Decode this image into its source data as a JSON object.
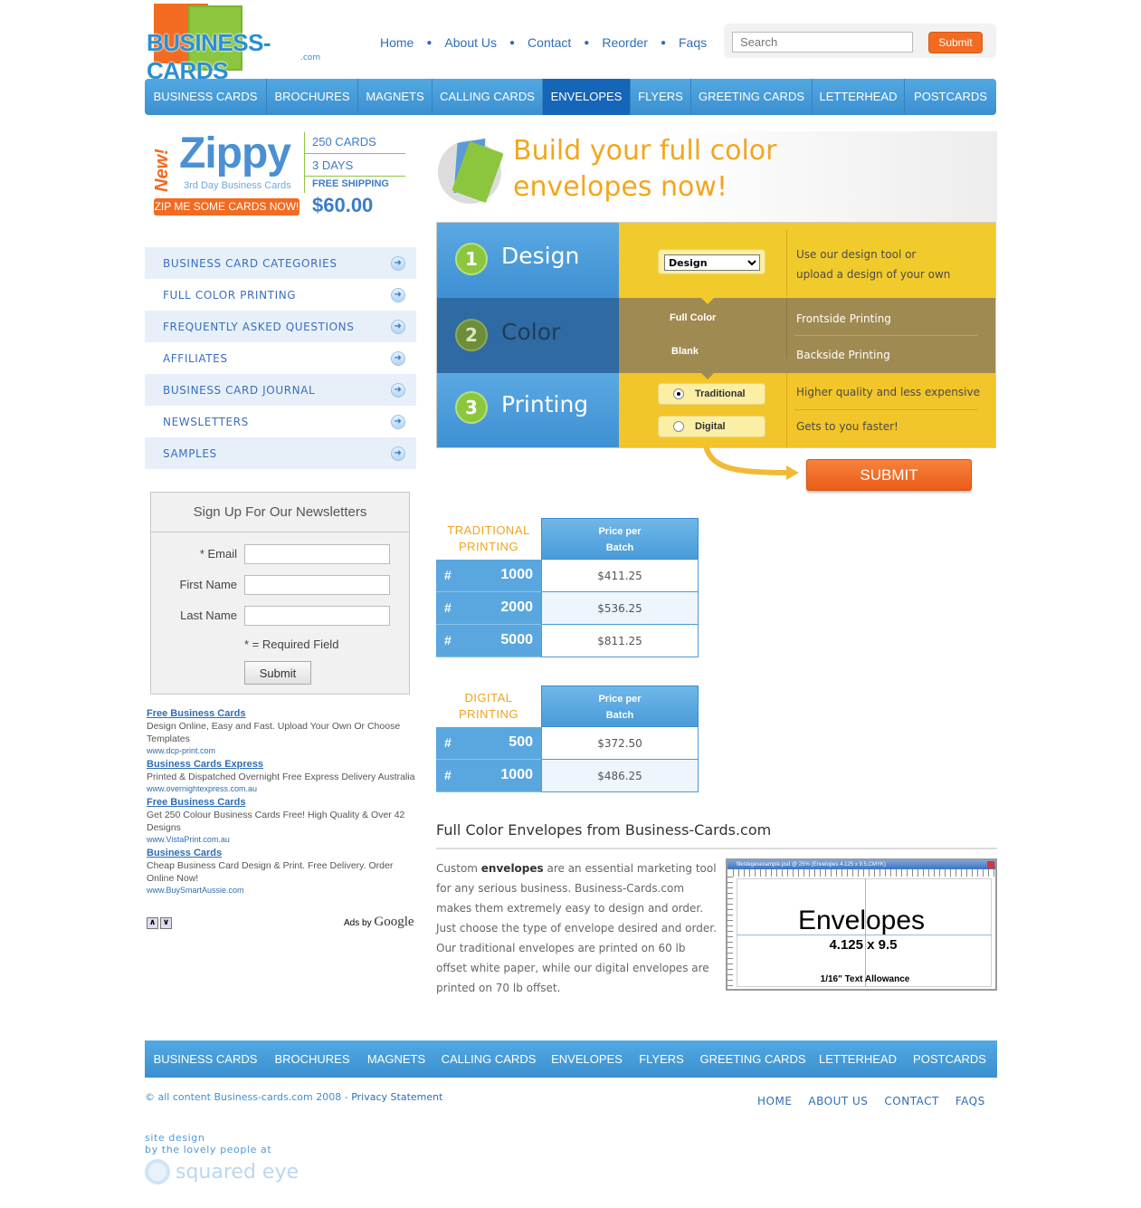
{
  "logo": {
    "text": "BUSINESS-CARDS",
    "suffix": ".com"
  },
  "top_nav": [
    "Home",
    "About Us",
    "Contact",
    "Reorder",
    "Faqs"
  ],
  "search": {
    "placeholder": "Search",
    "submit": "Submit"
  },
  "main_nav": {
    "items": [
      "BUSINESS CARDS",
      "BROCHURES",
      "MAGNETS",
      "CALLING CARDS",
      "ENVELOPES",
      "FLYERS",
      "GREETING CARDS",
      "LETTERHEAD",
      "POSTCARDS"
    ],
    "active": "ENVELOPES"
  },
  "promo": {
    "new": "New!",
    "title": "Zippy",
    "subtitle": "3rd Day Business Cards",
    "cta": "ZIP ME SOME CARDS NOW!",
    "cards": "250 CARDS",
    "days": "3 DAYS",
    "shipping": "FREE SHIPPING",
    "price": "$60.00"
  },
  "side_menu": [
    "BUSINESS CARD CATEGORIES",
    "FULL COLOR PRINTING",
    "FREQUENTLY ASKED QUESTIONS",
    "AFFILIATES",
    "BUSINESS CARD JOURNAL",
    "NEWSLETTERS",
    "SAMPLES"
  ],
  "newsletter": {
    "title": "Sign Up For Our Newsletters",
    "email_label": "* Email",
    "first_name_label": "First Name",
    "last_name_label": "Last Name",
    "required_note": "* = Required Field",
    "submit": "Submit"
  },
  "ads": [
    {
      "title": "Free Business Cards",
      "desc": "Design Online, Easy and Fast. Upload Your Own Or Choose Templates",
      "url": "www.dcp-print.com"
    },
    {
      "title": "Business Cards Express",
      "desc": "Printed & Dispatched Overnight Free Express Delivery Australia",
      "url": "www.overnightexpress.com.au"
    },
    {
      "title": "Free Business Cards",
      "desc": "Get 250 Colour Business Cards Free! High Quality & Over 42 Designs",
      "url": "www.VistaPrint.com.au"
    },
    {
      "title": "Business Cards",
      "desc": "Cheap Business Card Design & Print. Free Delivery. Order Online Now!",
      "url": "www.BuySmartAussie.com"
    }
  ],
  "ads_by": {
    "prefix": "Ads by",
    "brand": "Google"
  },
  "hero": {
    "line1": "Build your full color",
    "line2": "envelopes now!"
  },
  "steps": {
    "design": {
      "num": "1",
      "name": "Design",
      "select_value": "Design",
      "desc1": "Use our design tool or",
      "desc2": "upload a design of your own"
    },
    "color": {
      "num": "2",
      "name": "Color",
      "opt1": "Full Color",
      "opt2": "Blank",
      "desc1": "Frontside Printing",
      "desc2": "Backside Printing"
    },
    "printing": {
      "num": "3",
      "name": "Printing",
      "opt1": "Traditional",
      "opt2": "Digital",
      "desc1": "Higher quality and less expensive",
      "desc2": "Gets to you faster!",
      "selected": "Traditional"
    }
  },
  "submit_label": "SUBMIT",
  "traditional_table": {
    "label1": "TRADITIONAL",
    "label2": "PRINTING",
    "header1": "Price per",
    "header2": "Batch",
    "rows": [
      {
        "hash": "#",
        "qty": "1000",
        "price": "$411.25"
      },
      {
        "hash": "#",
        "qty": "2000",
        "price": "$536.25"
      },
      {
        "hash": "#",
        "qty": "5000",
        "price": "$811.25"
      }
    ]
  },
  "digital_table": {
    "label1": "DIGITAL",
    "label2": "PRINTING",
    "header1": "Price per",
    "header2": "Batch",
    "rows": [
      {
        "hash": "#",
        "qty": "500",
        "price": "$372.50"
      },
      {
        "hash": "#",
        "qty": "1000",
        "price": "$486.25"
      }
    ]
  },
  "article": {
    "title": "Full Color Envelopes from Business-Cards.com",
    "before": "Custom ",
    "bold": "envelopes",
    "after": " are an essential marketing tool for any serious business. Business-Cards.com makes them extremely easy to design and order. Just choose the type of envelope desired and order. Our traditional envelopes are printed on 60 lb offset white paper, while our digital envelopes are printed on 70 lb offset."
  },
  "figure": {
    "caption": "filestegesexample.psd @ 25% (Envelopes 4.125 x 9.5,CMYK)",
    "title": "Envelopes",
    "dimensions": "4.125 x 9.5",
    "allowance": "1/16\" Text Allowance"
  },
  "footer_nav": [
    "BUSINESS CARDS",
    "BROCHURES",
    "MAGNETS",
    "CALLING CARDS",
    "ENVELOPES",
    "FLYERS",
    "GREETING CARDS",
    "LETTERHEAD",
    "POSTCARDS"
  ],
  "copyright": {
    "text": "© all content Business-cards.com 2008 - ",
    "privacy": "Privacy Statement"
  },
  "footer_links": [
    "HOME",
    "ABOUT US",
    "CONTACT",
    "FAQS"
  ],
  "credit": {
    "line1": "site design",
    "line2": "by the lovely people at",
    "brand": "squared eye"
  },
  "colors": {
    "brand_blue": "#3b8fd0",
    "accent_orange": "#f26b21",
    "accent_yellow": "#f1cb2c",
    "brand_green": "#8cc63f"
  }
}
